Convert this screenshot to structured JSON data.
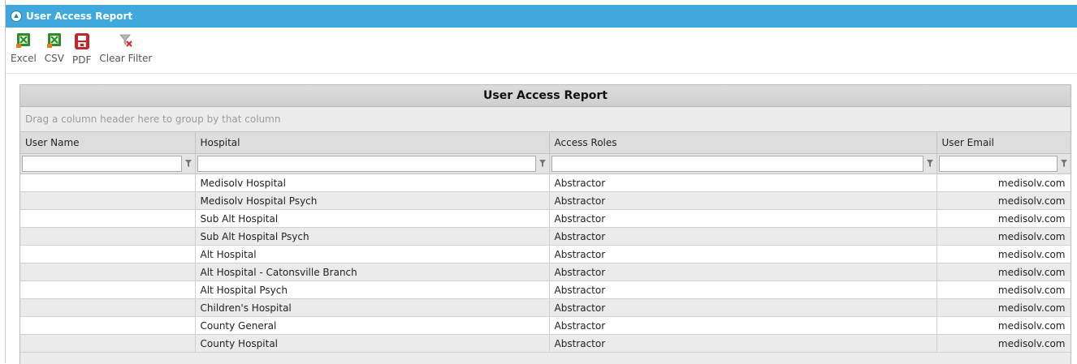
{
  "window": {
    "title": "User Access Report"
  },
  "toolbar": {
    "items": [
      {
        "label": "Excel",
        "icon": "excel-icon"
      },
      {
        "label": "CSV",
        "icon": "csv-icon"
      },
      {
        "label": "PDF",
        "icon": "pdf-icon"
      },
      {
        "label": "Clear Filter",
        "icon": "clear-filter-icon"
      }
    ]
  },
  "grid": {
    "title": "User Access Report",
    "group_hint": "Drag a column header here to group by that column",
    "columns": [
      "User Name",
      "Hospital",
      "Access Roles",
      "User Email"
    ],
    "filters": [
      "",
      "",
      "",
      ""
    ],
    "rows": [
      {
        "user": "",
        "hospital": "Medisolv Hospital",
        "role": "Abstractor",
        "email": "medisolv.com"
      },
      {
        "user": "",
        "hospital": "Medisolv Hospital Psych",
        "role": "Abstractor",
        "email": "medisolv.com"
      },
      {
        "user": "",
        "hospital": "Sub Alt Hospital",
        "role": "Abstractor",
        "email": "medisolv.com"
      },
      {
        "user": "",
        "hospital": "Sub Alt Hospital Psych",
        "role": "Abstractor",
        "email": "medisolv.com"
      },
      {
        "user": "",
        "hospital": "Alt Hospital",
        "role": "Abstractor",
        "email": "medisolv.com"
      },
      {
        "user": "",
        "hospital": "Alt Hospital - Catonsville Branch",
        "role": "Abstractor",
        "email": "medisolv.com"
      },
      {
        "user": "",
        "hospital": "Alt Hospital Psych",
        "role": "Abstractor",
        "email": "medisolv.com"
      },
      {
        "user": "",
        "hospital": "Children's Hospital",
        "role": "Abstractor",
        "email": "medisolv.com"
      },
      {
        "user": "",
        "hospital": "County General",
        "role": "Abstractor",
        "email": "medisolv.com"
      },
      {
        "user": "",
        "hospital": "County Hospital",
        "role": "Abstractor",
        "email": "medisolv.com"
      }
    ]
  },
  "colors": {
    "titlebar": "#3fa9dd",
    "excel": "#2e8b2e",
    "pdf": "#c0272d"
  }
}
